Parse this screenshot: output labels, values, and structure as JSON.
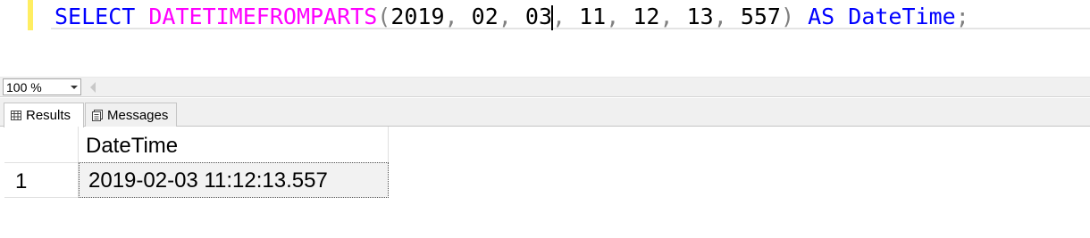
{
  "editor": {
    "sql": {
      "select": "SELECT",
      "function": "DATETIMEFROMPARTS",
      "open_paren": "(",
      "arg1": "2019",
      "arg2": "02",
      "arg3": "03",
      "arg4": "11",
      "arg5": "12",
      "arg6": "13",
      "arg7": "557",
      "comma": ",",
      "close_paren": ")",
      "as": "AS",
      "alias": "DateTime",
      "semicolon": ";"
    }
  },
  "zoom": {
    "value": "100 %"
  },
  "tabs": {
    "results": "Results",
    "messages": "Messages"
  },
  "grid": {
    "columns": [
      "DateTime"
    ],
    "rows": [
      {
        "num": "1",
        "cells": [
          "2019-02-03 11:12:13.557"
        ]
      }
    ]
  },
  "colors": {
    "keyword": "#0000ff",
    "function": "#ff00ff",
    "punctuation": "#808080",
    "line_marker": "#ffee62"
  }
}
